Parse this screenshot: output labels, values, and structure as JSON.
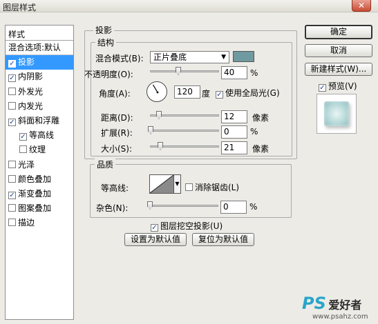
{
  "window": {
    "title": "图层样式",
    "close_symbol": "✕"
  },
  "styles_panel": {
    "header": "样式",
    "blend_item": "混合选项:默认",
    "items": [
      {
        "label": "投影",
        "checked": true
      },
      {
        "label": "内阴影",
        "checked": true
      },
      {
        "label": "外发光",
        "checked": false
      },
      {
        "label": "内发光",
        "checked": false
      },
      {
        "label": "斜面和浮雕",
        "checked": true
      },
      {
        "label": "等高线",
        "checked": true
      },
      {
        "label": "纹理",
        "checked": false
      },
      {
        "label": "光泽",
        "checked": false
      },
      {
        "label": "颜色叠加",
        "checked": false
      },
      {
        "label": "渐变叠加",
        "checked": true
      },
      {
        "label": "图案叠加",
        "checked": false
      },
      {
        "label": "描边",
        "checked": false
      }
    ]
  },
  "drop_shadow": {
    "section_title": "投影",
    "structure": {
      "title": "结构",
      "blend_mode_label": "混合模式(B):",
      "blend_mode_value": "正片叠底",
      "shadow_color": "#6f9aa0",
      "opacity_label": "不透明度(O):",
      "opacity_value": "40",
      "opacity_unit": "%",
      "opacity_fraction": 0.4,
      "angle_label": "角度(A):",
      "angle_value": "120",
      "angle_unit": "度",
      "global_light_label": "使用全局光(G)",
      "global_light_checked": true,
      "distance_label": "距离(D):",
      "distance_value": "12",
      "distance_unit": "像素",
      "spread_label": "扩展(R):",
      "spread_value": "0",
      "spread_unit": "%",
      "size_label": "大小(S):",
      "size_value": "21",
      "size_unit": "像素"
    },
    "quality": {
      "title": "品质",
      "contour_label": "等高线:",
      "anti_alias_label": "消除锯齿(L)",
      "anti_alias_checked": false,
      "noise_label": "杂色(N):",
      "noise_value": "0",
      "noise_unit": "%"
    },
    "knockout_label": "图层挖空投影(U)",
    "knockout_checked": true,
    "set_default_label": "设置为默认值",
    "reset_default_label": "复位为默认值"
  },
  "actions": {
    "ok_label": "确定",
    "cancel_label": "取消",
    "new_style_label": "新建样式(W)...",
    "preview_label": "预览(V)",
    "preview_checked": true
  },
  "watermark": {
    "brand": "PS",
    "text": "爱好者",
    "url": "www.psahz.com"
  }
}
